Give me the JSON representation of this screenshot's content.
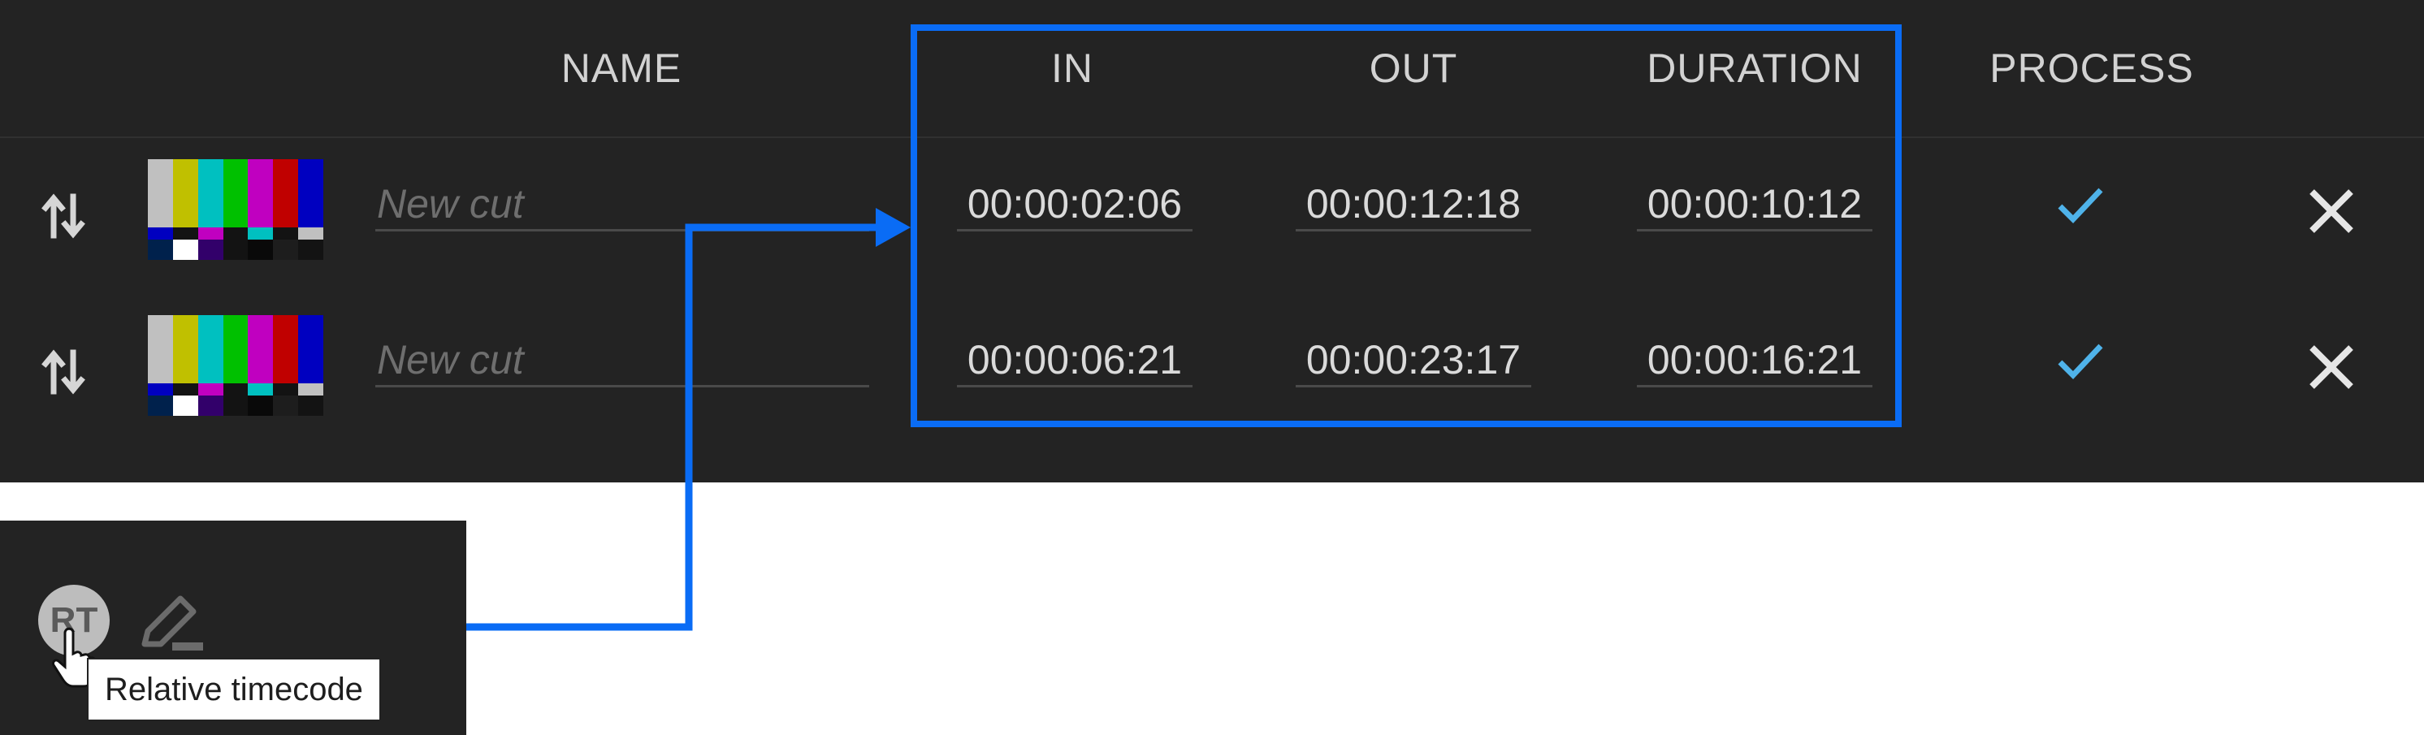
{
  "columns": {
    "name": "NAME",
    "in": "IN",
    "out": "OUT",
    "duration": "DURATION",
    "process": "PROCESS"
  },
  "rows": [
    {
      "name_placeholder": "New cut",
      "in": "00:00:02:06",
      "out": "00:00:12:18",
      "duration": "00:00:10:12",
      "process_checked": true,
      "icons": {
        "sort": "sort-arrows-icon",
        "thumbnail": "color-bars-thumbnail",
        "check": "check-icon",
        "delete": "close-icon"
      }
    },
    {
      "name_placeholder": "New cut",
      "in": "00:00:06:21",
      "out": "00:00:23:17",
      "duration": "00:00:16:21",
      "process_checked": true,
      "icons": {
        "sort": "sort-arrows-icon",
        "thumbnail": "color-bars-thumbnail",
        "check": "check-icon",
        "delete": "close-icon"
      }
    }
  ],
  "toolbar": {
    "rt_button_label": "RT",
    "tooltip": "Relative timecode",
    "icons": {
      "edit": "pencil-icon",
      "cursor": "hand-pointer-icon"
    }
  },
  "colors": {
    "panel_bg": "#232323",
    "header_text": "#d2d2d2",
    "value_text": "#dadada",
    "placeholder_text": "#6e6e6e",
    "check": "#4fb3ea",
    "highlight": "#0a6cf5"
  }
}
